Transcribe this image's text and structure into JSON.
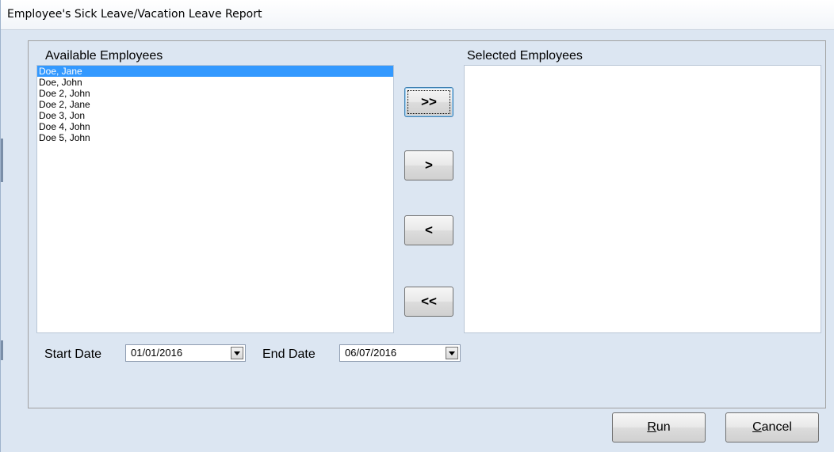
{
  "window": {
    "title": "Employee's Sick Leave/Vacation Leave Report"
  },
  "available": {
    "label": "Available Employees",
    "items": [
      "Doe, Jane",
      "Doe, John",
      "Doe 2, John",
      "Doe 2, Jane",
      "Doe 3, Jon",
      "Doe 4, John",
      "Doe 5, John"
    ],
    "selected_index": 0
  },
  "selected": {
    "label": "Selected Employees",
    "items": []
  },
  "transfer": {
    "add_all": ">>",
    "add": ">",
    "remove": "<",
    "remove_all": "<<"
  },
  "dates": {
    "start_label": "Start Date",
    "start_value": "01/01/2016",
    "end_label": "End Date",
    "end_value": "06/07/2016"
  },
  "actions": {
    "run_mnemonic": "R",
    "run_rest": "un",
    "cancel_mnemonic": "C",
    "cancel_rest": "ancel"
  }
}
